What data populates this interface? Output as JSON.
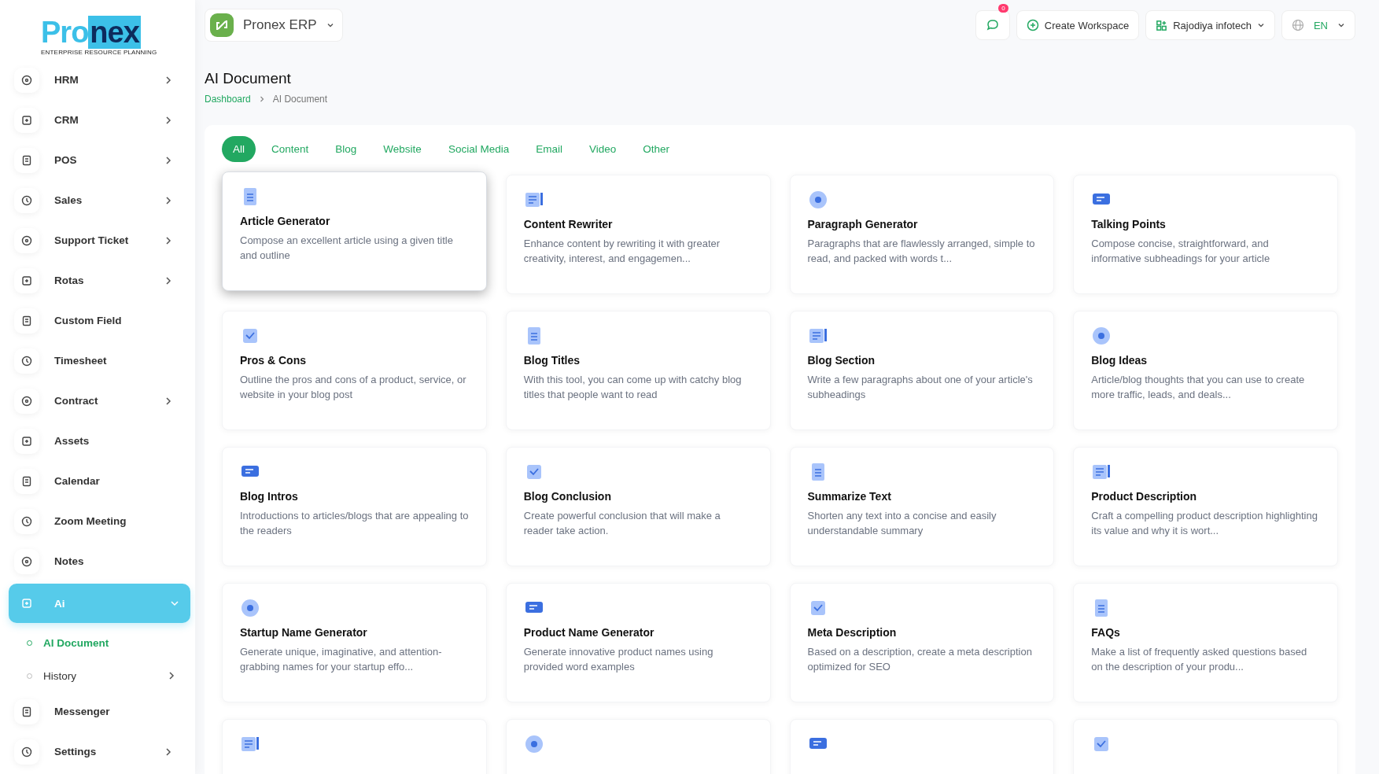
{
  "logo": {
    "brand_first": "Pro",
    "brand_second": "nex",
    "tagline": "ENTERPRISE RESOURCE PLANNING"
  },
  "sidebar": {
    "items": [
      {
        "label": "HRM",
        "expandable": true,
        "selected": false
      },
      {
        "label": "CRM",
        "expandable": true,
        "selected": false
      },
      {
        "label": "POS",
        "expandable": true,
        "selected": false
      },
      {
        "label": "Sales",
        "expandable": true,
        "selected": false
      },
      {
        "label": "Support Ticket",
        "expandable": true,
        "selected": false
      },
      {
        "label": "Rotas",
        "expandable": true,
        "selected": false
      },
      {
        "label": "Custom Field",
        "expandable": false,
        "selected": false
      },
      {
        "label": "Timesheet",
        "expandable": false,
        "selected": false
      },
      {
        "label": "Contract",
        "expandable": true,
        "selected": false
      },
      {
        "label": "Assets",
        "expandable": false,
        "selected": false
      },
      {
        "label": "Calendar",
        "expandable": false,
        "selected": false
      },
      {
        "label": "Zoom Meeting",
        "expandable": false,
        "selected": false
      },
      {
        "label": "Notes",
        "expandable": false,
        "selected": false
      },
      {
        "label": "Ai",
        "expandable": true,
        "selected": true,
        "expanded": true,
        "children": [
          {
            "label": "AI Document",
            "expandable": false,
            "selected": true
          },
          {
            "label": "History",
            "expandable": true,
            "selected": false
          }
        ]
      },
      {
        "label": "Messenger",
        "expandable": false,
        "selected": false
      },
      {
        "label": "Settings",
        "expandable": true,
        "selected": false
      }
    ]
  },
  "header": {
    "app_name": "Pronex ERP",
    "notification_count": "0",
    "create_workspace": "Create Workspace",
    "workspace": "Rajodiya infotech",
    "language": "EN"
  },
  "page": {
    "title": "AI Document",
    "breadcrumb": [
      "Dashboard",
      "AI Document"
    ]
  },
  "tabs": [
    {
      "label": "All",
      "selected": true
    },
    {
      "label": "Content",
      "selected": false
    },
    {
      "label": "Blog",
      "selected": false
    },
    {
      "label": "Website",
      "selected": false
    },
    {
      "label": "Social Media",
      "selected": false
    },
    {
      "label": "Email",
      "selected": false
    },
    {
      "label": "Video",
      "selected": false
    },
    {
      "label": "Other",
      "selected": false
    }
  ],
  "cards": [
    {
      "kind": "full",
      "title": "Article Generator",
      "description": "Compose an excellent article using a given title and outline",
      "selected": true
    },
    {
      "kind": "full",
      "title": "Content Rewriter",
      "description": "Enhance content by rewriting it with greater creativity, interest, and engagemen...",
      "selected": false
    },
    {
      "kind": "full",
      "title": "Paragraph Generator",
      "description": "Paragraphs that are flawlessly arranged, simple to read, and packed with words t...",
      "selected": false
    },
    {
      "kind": "full",
      "title": "Talking Points",
      "description": "Compose concise, straightforward, and informative subheadings for your article",
      "selected": false
    },
    {
      "kind": "full",
      "title": "Pros & Cons",
      "description": "Outline the pros and cons of a product, service, or website in your blog post",
      "selected": false
    },
    {
      "kind": "full",
      "title": "Blog Titles",
      "description": "With this tool, you can come up with catchy blog titles that people want to read",
      "selected": false
    },
    {
      "kind": "full",
      "title": "Blog Section",
      "description": "Write a few paragraphs about one of your article's subheadings",
      "selected": false
    },
    {
      "kind": "full",
      "title": "Blog Ideas",
      "description": "Article/blog thoughts that you can use to create more traffic, leads, and deals...",
      "selected": false
    },
    {
      "kind": "full",
      "title": "Blog Intros",
      "description": "Introductions to articles/blogs that are appealing to the readers",
      "selected": false
    },
    {
      "kind": "full",
      "title": "Blog Conclusion",
      "description": "Create powerful conclusion that will make a reader take action.",
      "selected": false
    },
    {
      "kind": "full",
      "title": "Summarize Text",
      "description": "Shorten any text into a concise and easily understandable summary",
      "selected": false
    },
    {
      "kind": "full",
      "title": "Product Description",
      "description": "Craft a compelling product description highlighting its value and why it is wort...",
      "selected": false
    },
    {
      "kind": "full",
      "title": "Startup Name Generator",
      "description": "Generate unique, imaginative, and attention-grabbing names for your startup effo...",
      "selected": false
    },
    {
      "kind": "full",
      "title": "Product Name Generator",
      "description": "Generate innovative product names using provided word examples",
      "selected": false
    },
    {
      "kind": "full",
      "title": "Meta Description",
      "description": "Based on a description, create a meta description optimized for SEO",
      "selected": false
    },
    {
      "kind": "full",
      "title": "FAQs",
      "description": "Make a list of frequently asked questions based on the description of your produ...",
      "selected": false
    },
    {
      "kind": "cut",
      "selected": false
    },
    {
      "kind": "cut",
      "selected": false
    },
    {
      "kind": "cut",
      "selected": false
    },
    {
      "kind": "cut",
      "selected": false
    }
  ]
}
